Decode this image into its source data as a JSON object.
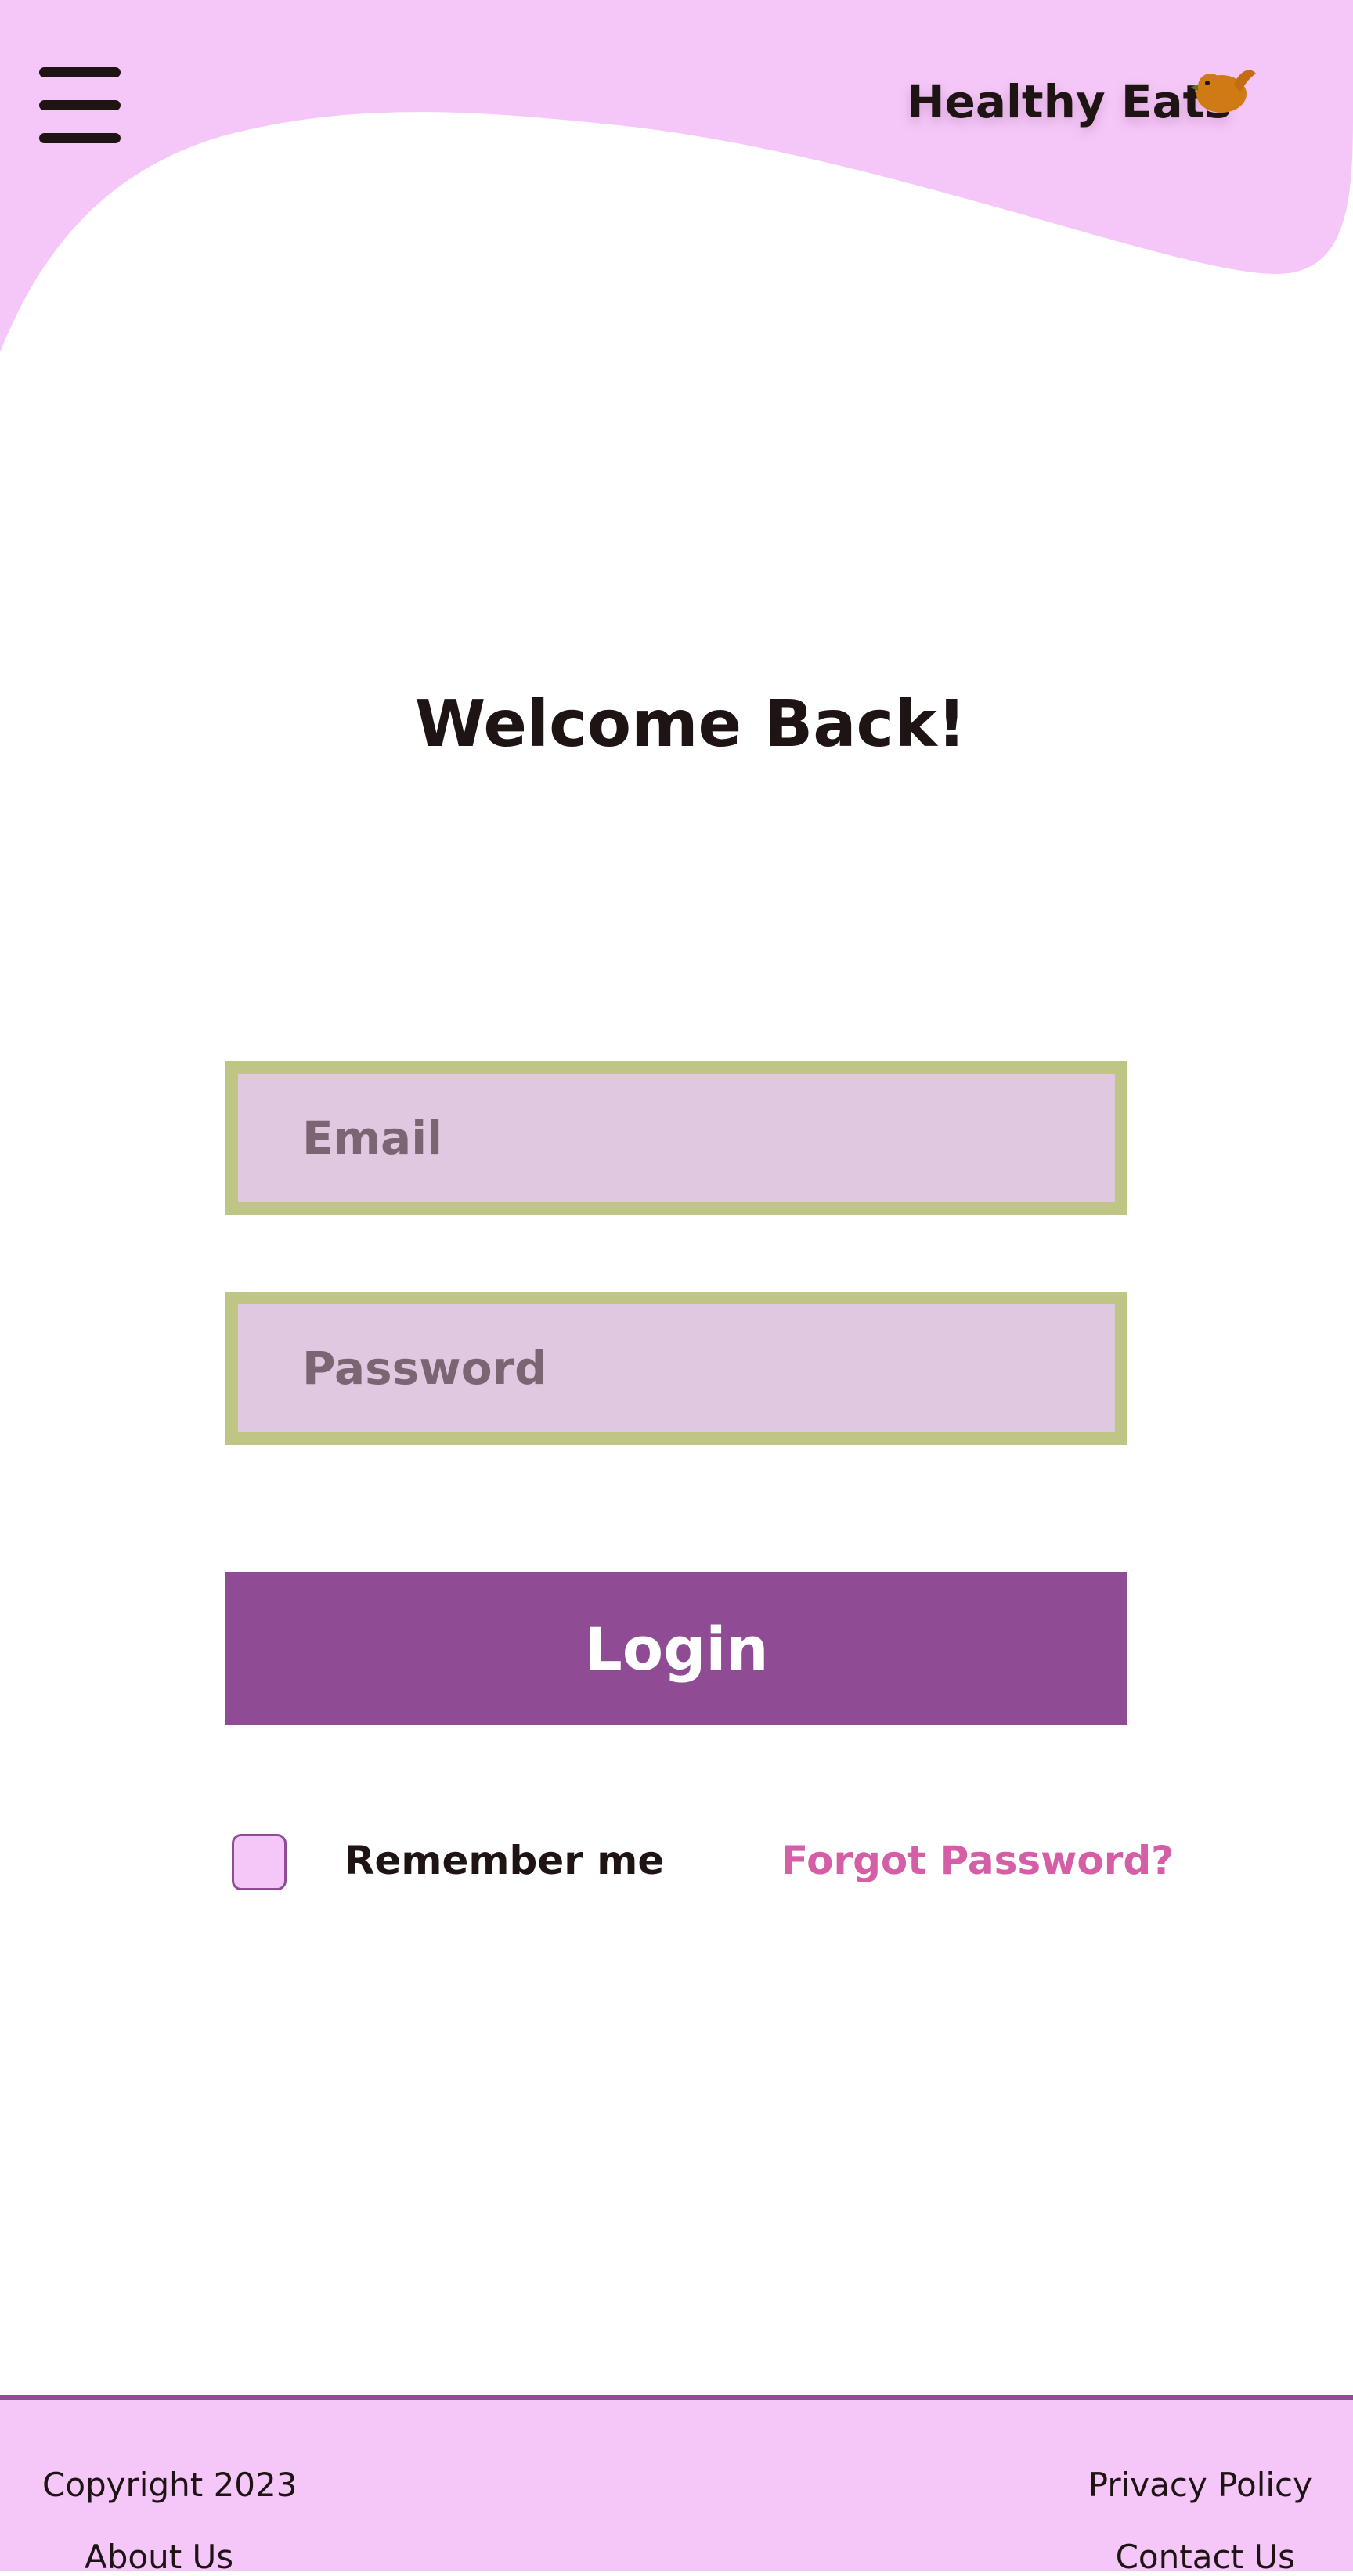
{
  "header": {
    "brand_name": "Healthy Eats",
    "menu_icon": "hamburger-menu-icon",
    "mascot_icon": "bird-icon"
  },
  "main": {
    "title": "Welcome Back!",
    "email_placeholder": "Email",
    "email_value": "",
    "password_placeholder": "Password",
    "password_value": "",
    "login_label": "Login",
    "remember_label": "Remember me",
    "remember_checked": false,
    "forgot_label": "Forgot Password?"
  },
  "footer": {
    "copyright": "Copyright 2023",
    "about": "About Us",
    "privacy": "Privacy Policy",
    "contact": "Contact Us"
  },
  "colors": {
    "header_pink": "#f5c7f8",
    "field_background": "#dfc8e0",
    "field_border": "#bfc685",
    "primary_purple": "#8f4c94",
    "link_pink": "#d45fa6",
    "text_dark": "#1e1414",
    "mascot_orange": "#d07a16"
  }
}
